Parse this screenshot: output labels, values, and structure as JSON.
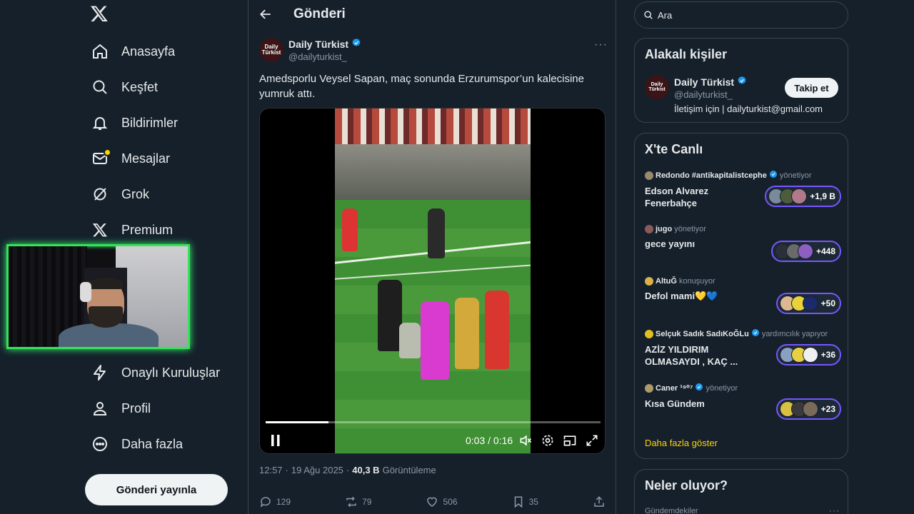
{
  "nav": {
    "items": [
      {
        "label": "Anasayfa",
        "icon": "home-icon"
      },
      {
        "label": "Keşfet",
        "icon": "search-icon"
      },
      {
        "label": "Bildirimler",
        "icon": "bell-icon"
      },
      {
        "label": "Mesajlar",
        "icon": "mail-icon"
      },
      {
        "label": "Grok",
        "icon": "grok-icon"
      },
      {
        "label": "Premium",
        "icon": "x-icon"
      },
      {
        "label": "Onaylı Kuruluşlar",
        "icon": "lightning-icon"
      },
      {
        "label": "Profil",
        "icon": "person-icon"
      },
      {
        "label": "Daha fazla",
        "icon": "more-circle-icon"
      }
    ],
    "post_button": "Gönderi yayınla"
  },
  "header": {
    "title": "Gönderi"
  },
  "tweet": {
    "avatar_text": "Daily Türkist",
    "author": "Daily Türkist",
    "handle": "@dailyturkist_",
    "text": "Amedsporlu Veysel Sapan, maç sonunda Erzurumspor’un kalecisine yumruk attı.",
    "video": {
      "time": "0:03 / 0:16",
      "progress": 0.1875
    },
    "time": "12:57",
    "separator": "·",
    "date": "19 Ağu 2025",
    "views": "40,3 B",
    "views_label": "Görüntüleme",
    "replies": "129",
    "reposts": "79",
    "likes": "506",
    "bookmarks": "35"
  },
  "search": {
    "placeholder": "Ara"
  },
  "related": {
    "title": "Alakalı kişiler",
    "name": "Daily Türkist",
    "handle": "@dailyturkist_",
    "bio": "İletişim için | dailyturkist@gmail.com",
    "follow_label": "Takip et"
  },
  "live": {
    "title": "X'te Canlı",
    "items": [
      {
        "host": "Redondo #antikapitalistcephe",
        "status": "yönetiyor",
        "topic": "Edson Alvarez Fenerbahçe",
        "count": "+1,9 B"
      },
      {
        "host": "jugo",
        "status": "yönetiyor",
        "topic": "gece yayını",
        "count": "+448"
      },
      {
        "host": "AltuĞ",
        "status": "konuşuyor",
        "topic": "Defol mami💛💙",
        "count": "+50"
      },
      {
        "host": "Selçuk Sadık SadıKoĞLu",
        "status": "yardımcılık yapıyor",
        "topic": "AZİZ YILDIRIM OLMASAYDI , KAÇ ...",
        "count": "+36"
      },
      {
        "host": "Caner ¹⁹⁰⁷",
        "status": "yönetiyor",
        "topic": "Kısa Gündem",
        "count": "+23"
      }
    ],
    "show_more": "Daha fazla göster"
  },
  "trends": {
    "title": "Neler oluyor?",
    "subtitle": "Gündemdekiler"
  },
  "colors": {
    "accent": "#1d9bf0",
    "live_border": "#7856ff",
    "notification_dot": "#ffd400",
    "background": "#15202b"
  }
}
